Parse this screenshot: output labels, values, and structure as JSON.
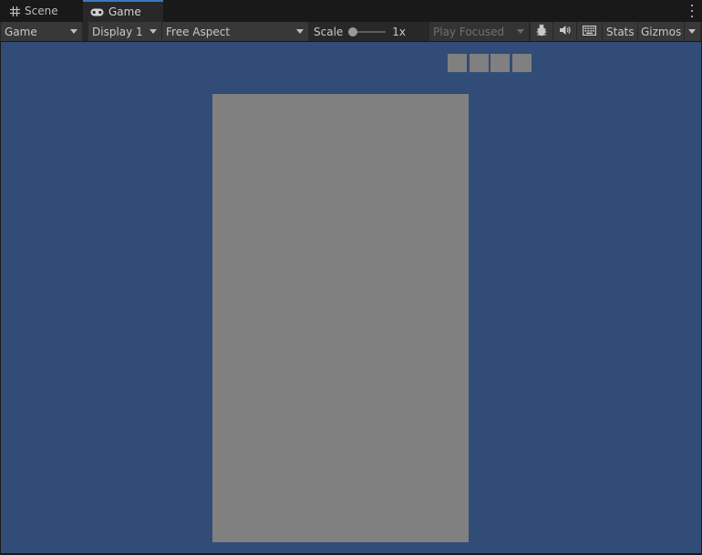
{
  "tabs": [
    {
      "label": "Scene",
      "icon": "grid-icon",
      "active": false
    },
    {
      "label": "Game",
      "icon": "gamepad-icon",
      "active": true
    }
  ],
  "toolbar": {
    "view_select": "Game",
    "display_select": "Display 1",
    "aspect_select": "Free Aspect",
    "scale_label": "Scale",
    "scale_value": "1x",
    "play_mode": "Play Focused",
    "stats_label": "Stats",
    "gizmos_label": "Gizmos"
  },
  "colors": {
    "viewport_bg": "#314c77",
    "panel": "#808080",
    "accent": "#3a79bb"
  }
}
